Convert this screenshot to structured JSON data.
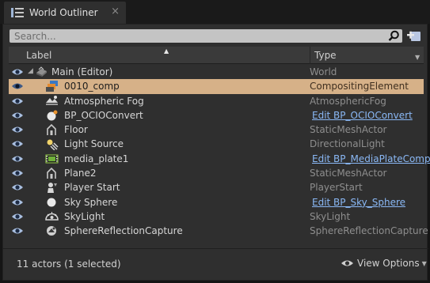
{
  "tab": {
    "title": "World Outliner",
    "close_label": "×"
  },
  "search": {
    "placeholder": "Search..."
  },
  "columns": {
    "label": "Label",
    "type": "Type"
  },
  "rows": [
    {
      "label": "Main (Editor)",
      "type": "World",
      "icon": "world-icon",
      "link": false
    },
    {
      "label": "0010_comp",
      "type": "CompositingElement",
      "icon": "compositing-icon",
      "link": false,
      "selected": true
    },
    {
      "label": "Atmospheric Fog",
      "type": "AtmosphericFog",
      "icon": "fog-icon",
      "link": false
    },
    {
      "label": "BP_OCIOConvert",
      "type": "Edit BP_OCIOConvert",
      "icon": "blueprint-sphere-icon",
      "link": true
    },
    {
      "label": "Floor",
      "type": "StaticMeshActor",
      "icon": "static-mesh-icon",
      "link": false
    },
    {
      "label": "Light Source",
      "type": "DirectionalLight",
      "icon": "light-icon",
      "link": false
    },
    {
      "label": "media_plate1",
      "type": "Edit BP_MediaPlateComp",
      "icon": "media-plate-icon",
      "link": true
    },
    {
      "label": "Plane2",
      "type": "StaticMeshActor",
      "icon": "static-mesh-icon",
      "link": false
    },
    {
      "label": "Player Start",
      "type": "PlayerStart",
      "icon": "player-start-icon",
      "link": false
    },
    {
      "label": "Sky Sphere",
      "type": "Edit BP_Sky_Sphere",
      "icon": "sphere-icon",
      "link": true
    },
    {
      "label": "SkyLight",
      "type": "SkyLight",
      "icon": "skylight-icon",
      "link": false
    },
    {
      "label": "SphereReflectionCapture",
      "type": "SphereReflectionCapture",
      "icon": "reflection-capture-icon",
      "link": false
    }
  ],
  "footer": {
    "status": "11 actors (1 selected)",
    "view_options": "View Options"
  },
  "colors": {
    "selected_row": "#d6b188",
    "link": "#8ab8f5",
    "panel": "#2f2f2f"
  }
}
